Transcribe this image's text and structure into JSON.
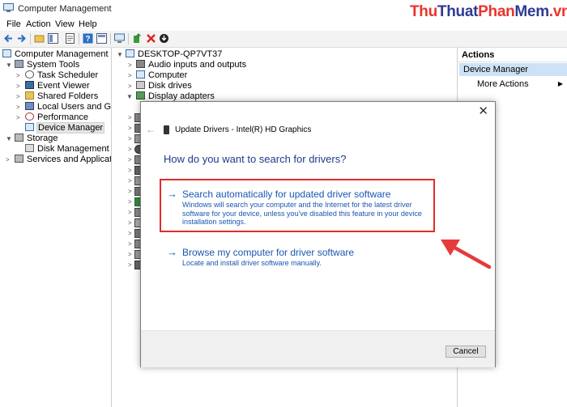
{
  "window": {
    "title": "Computer Management",
    "watermark": {
      "thu1": "Thu",
      "thuat": "Thuat",
      "phan": "Phan",
      "mem": "Mem",
      "vn": ".vn"
    }
  },
  "menu": {
    "file": "File",
    "action": "Action",
    "view": "View",
    "help": "Help"
  },
  "tree": {
    "root": "Computer Management (Local",
    "system_tools": "System Tools",
    "task_scheduler": "Task Scheduler",
    "event_viewer": "Event Viewer",
    "shared_folders": "Shared Folders",
    "local_users": "Local Users and Groups",
    "performance": "Performance",
    "device_manager": "Device Manager",
    "storage": "Storage",
    "disk_management": "Disk Management",
    "services": "Services and Applications"
  },
  "devices": {
    "computer_name": "DESKTOP-QP7VT37",
    "audio": "Audio inputs and outputs",
    "computer": "Computer",
    "disk_drives": "Disk drives",
    "display_adapters": "Display adapters"
  },
  "actions": {
    "header": "Actions",
    "selected": "Device Manager",
    "more": "More Actions"
  },
  "dialog": {
    "title": "Update Drivers - Intel(R) HD Graphics",
    "question": "How do you want to search for drivers?",
    "option_auto": {
      "title": "Search automatically for updated driver software",
      "description": "Windows will search your computer and the Internet for the latest driver software for your device, unless you've disabled this feature in your device installation settings."
    },
    "option_browse": {
      "title": "Browse my computer for driver software",
      "description": "Locate and install driver software manually."
    },
    "cancel": "Cancel"
  },
  "colors": {
    "link_blue": "#1a56b0",
    "highlight_red": "#e52a2a",
    "selection_blue": "#cde3f5"
  }
}
